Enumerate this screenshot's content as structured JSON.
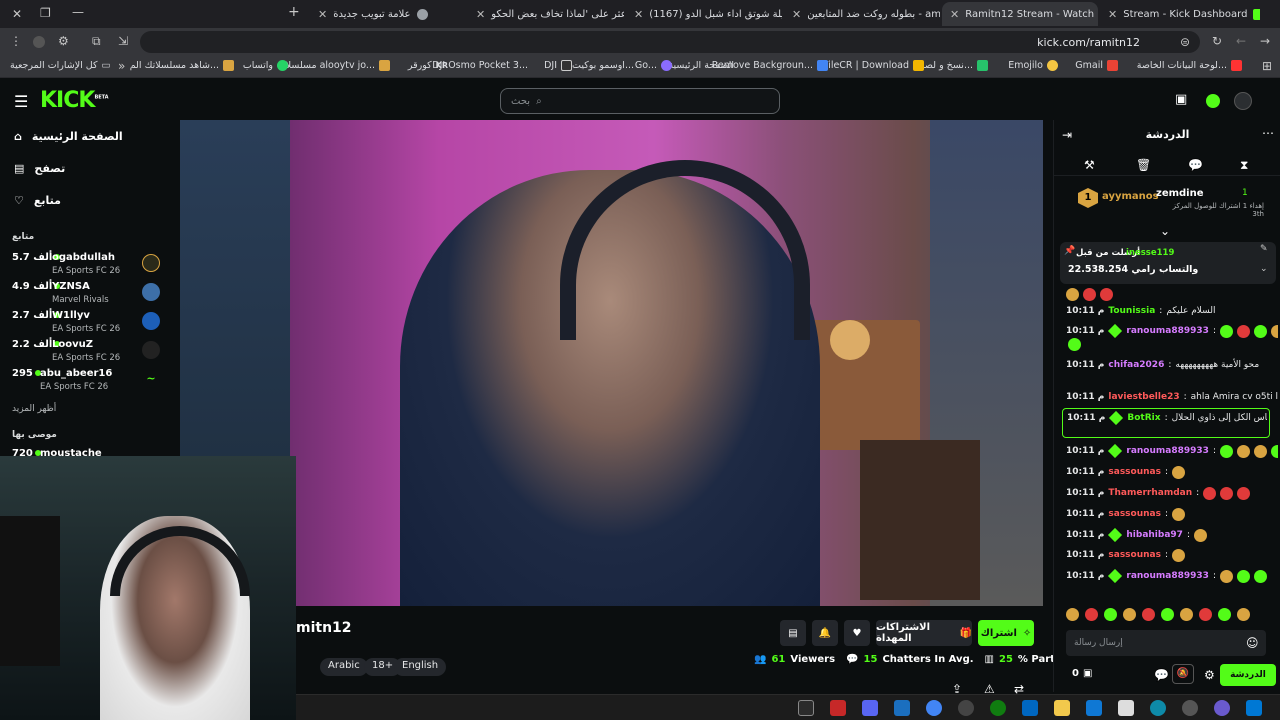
{
  "tabs": [
    {
      "title": "Stream - Kick Dashboard",
      "fav": "#53fc18"
    },
    {
      "title": "Ramitn12 Stream - Watch Live ...",
      "fav": "#53fc18",
      "active": true
    },
    {
      "title": "بطوله روكت ضد المتابعين - am...",
      "fav": "#3b6cff"
    },
    {
      "title": "(1167) شيلة شوتق اداء شبل الدو...",
      "fav": "#ff0000"
    },
    {
      "title": "اعثر على 'لماذا تخاف بعض الحكو...",
      "fav": "#ffffff"
    },
    {
      "title": "علامة تبويب جديدة",
      "fav": "#9aa0a6"
    }
  ],
  "address": {
    "url": "kick.com/ramitn12"
  },
  "bookmarks": [
    "لوحة البيانات الخاصة...",
    "Gmail",
    "Emojilo",
    "نسخ و لصق...",
    "FileCR | Download",
    "Remove Backgroun...",
    "الصفحة الرئيسية",
    "Go...",
    "اوسمو بوكيت 3...",
    "DJI",
    "DJI Osmo Pocket 3...",
    "كورقر",
    "مسلسلات alooytv jo...",
    "واتساب",
    "شاهد مسلسلاتك الم...",
    "كل الإشارات المرجعية"
  ],
  "header": {
    "logo": "KICK",
    "logo_beta": "BETA",
    "search_placeholder": "بحث"
  },
  "sidebar": {
    "nav": [
      {
        "label": "الصفحة الرئيسية",
        "icon": "home-icon"
      },
      {
        "label": "تصفح",
        "icon": "browse-icon"
      },
      {
        "label": "متابع",
        "icon": "heart-icon"
      }
    ],
    "following_title": "متابع",
    "channels": [
      {
        "name": "ogabdullah",
        "count": "5.7 ألف",
        "game": "EA Sports FC 26"
      },
      {
        "name": "YZNSA",
        "count": "4.9 ألف",
        "game": "Marvel Rivals"
      },
      {
        "name": "W1llyv",
        "count": "2.7 ألف",
        "game": "EA Sports FC 26"
      },
      {
        "name": "LoovuZ",
        "count": "2.2 ألف",
        "game": "EA Sports FC 26"
      },
      {
        "name": "abu_abeer16",
        "count": "295",
        "game": "EA Sports FC 26"
      }
    ],
    "show_more": "أظهر المزيد",
    "recommended_title": "موصى بها",
    "recommended": [
      {
        "name": "moustache",
        "count": "720"
      }
    ]
  },
  "stream": {
    "name_partial": "mitn12",
    "tags": [
      "Arabic",
      "18+",
      "English"
    ],
    "viewers_num": "61",
    "viewers_label": "Viewers",
    "chatters_num": "15",
    "chatters_label": "Chatters In Avg.",
    "participation_num": "25",
    "participation_label": "% Participation",
    "subscribe_label": "اشتراك",
    "gift_label": "الاشتراكات المهداة"
  },
  "chat": {
    "title": "الدردشة",
    "top": [
      {
        "name": "ayymanos",
        "num": "1"
      },
      {
        "name": "zemdine",
        "num": "1",
        "sub": "إهداء 1 اشتراك للوصول المركز 3th"
      }
    ],
    "pinned": {
      "user": "inesse119",
      "label": "أرسلت من قبل",
      "text": "والتساب رامي 22.538.254"
    },
    "messages": [
      {
        "time": "10:11 م",
        "user": "Tounissia",
        "color": "#53fc18",
        "text": "السلام عليكم",
        "badge": false
      },
      {
        "time": "10:11 م",
        "user": "ranouma889933",
        "color": "#d67cff",
        "text": "",
        "badge": true,
        "emotes": 5
      },
      {
        "time": "10:11 م",
        "user": "chifaa2026",
        "color": "#d67cff",
        "text": "محو الأمية هههههههههه",
        "badge": false
      },
      {
        "time": "10:11 م",
        "user": "laviestbelle23",
        "color": "#ff5a5a",
        "text": "ahla Amira cv o5ti l8aliya",
        "badge": false
      },
      {
        "time": "10:11 م",
        "user": "BotRix",
        "color": "#53fc18",
        "text": "مرحبا بالناس الكل إلى ذاوي الحلال",
        "badge": true
      },
      {
        "time": "10:11 م",
        "user": "ranouma889933",
        "color": "#d67cff",
        "text": "",
        "badge": true,
        "emotes": 5
      },
      {
        "time": "10:11 م",
        "user": "sassounas",
        "color": "#ff5a5a",
        "text": "",
        "badge": false,
        "emotes": 1
      },
      {
        "time": "10:11 م",
        "user": "Thamerrhamdan",
        "color": "#ff5a5a",
        "text": "",
        "badge": false,
        "emotes": 3
      },
      {
        "time": "10:11 م",
        "user": "sassounas",
        "color": "#ff5a5a",
        "text": "",
        "badge": false,
        "emotes": 1
      },
      {
        "time": "10:11 م",
        "user": "hibahiba97",
        "color": "#d67cff",
        "text": "",
        "badge": true,
        "emotes": 1
      },
      {
        "time": "10:11 م",
        "user": "sassounas",
        "color": "#ff5a5a",
        "text": "",
        "badge": false,
        "emotes": 1
      },
      {
        "time": "10:11 م",
        "user": "ranouma889933",
        "color": "#d67cff",
        "text": "",
        "badge": true,
        "emotes": 4
      }
    ],
    "input_placeholder": "إرسال رسالة",
    "send_label": "الدردشة",
    "points": "0"
  }
}
